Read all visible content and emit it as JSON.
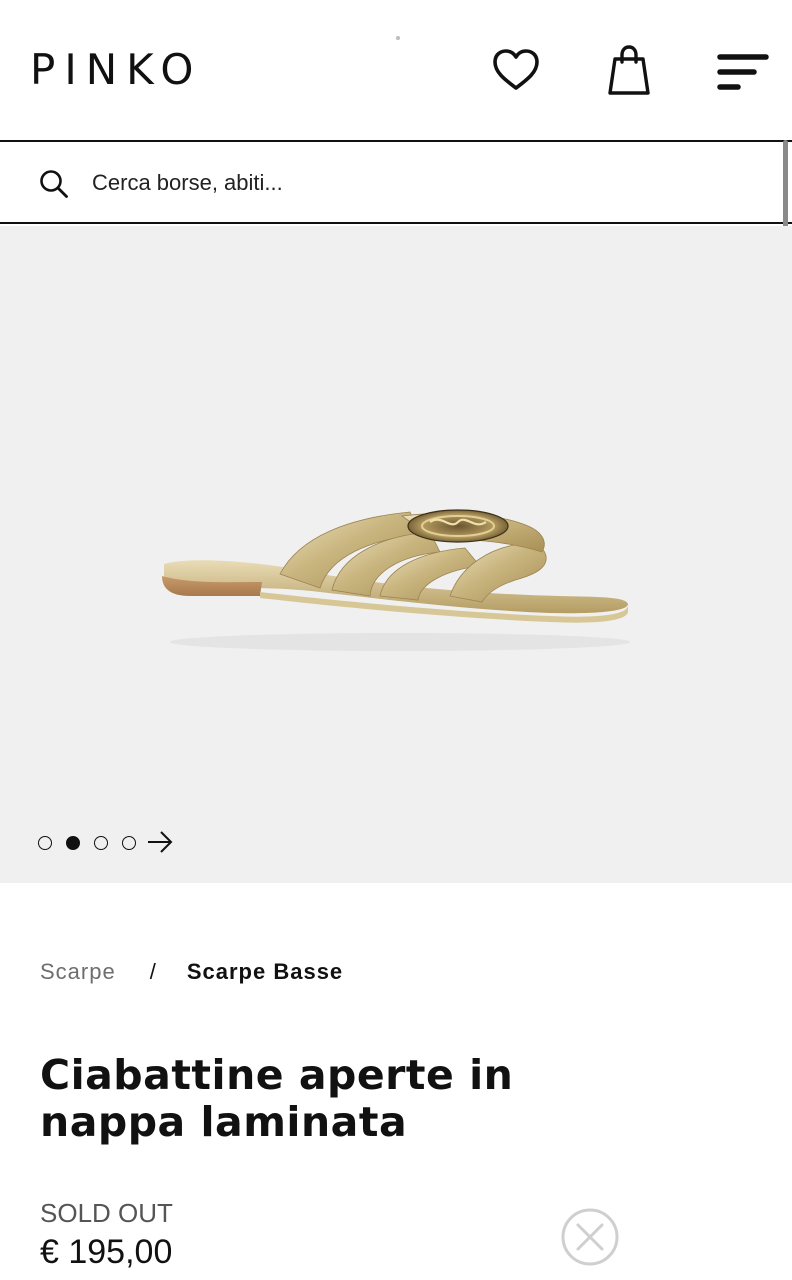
{
  "header": {
    "logo": "PINKO",
    "icons": {
      "wishlist": "heart-icon",
      "cart": "shopping-bag-icon",
      "menu": "menu-icon"
    }
  },
  "search": {
    "placeholder": "Cerca borse, abiti...",
    "value": "",
    "icon": "search-icon"
  },
  "gallery": {
    "image": "gold-laminated-nappa-slide-sandal",
    "slides": 4,
    "active_slide": 2,
    "next_icon": "arrow-right-icon"
  },
  "breadcrumb": {
    "items": [
      "Scarpe",
      "Scarpe Basse"
    ],
    "separator": "/"
  },
  "product": {
    "title": "Ciabattine aperte in nappa laminata",
    "availability": "SOLD OUT",
    "price": "€ 195,00"
  },
  "colors": {
    "text": "#111111",
    "muted": "#6e6e6e",
    "gallery_bg": "#f0f0f0",
    "close_icon": "#cfcfcf"
  }
}
